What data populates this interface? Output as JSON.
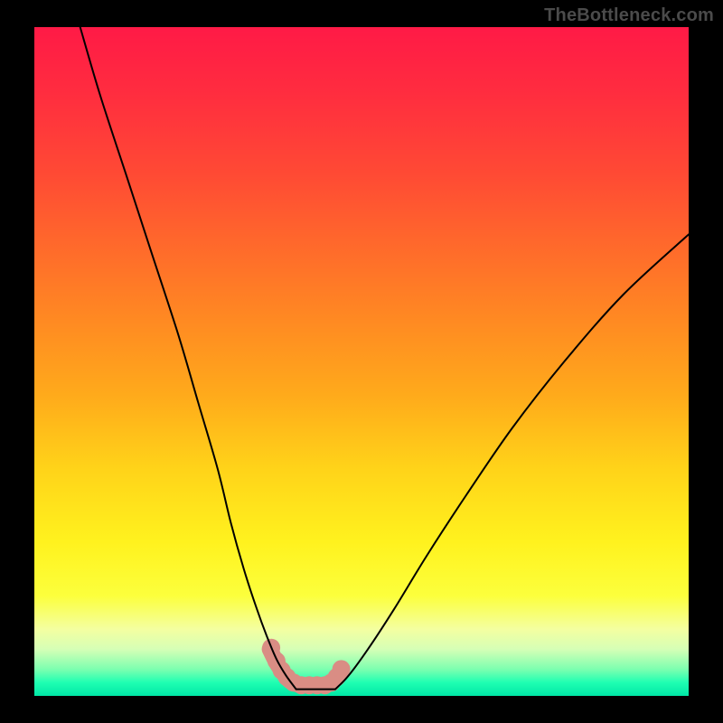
{
  "watermark": "TheBottleneck.com",
  "colors": {
    "frame": "#000000",
    "curve": "#000000",
    "accent": "#d98d84",
    "gradient_top": "#ff1a46",
    "gradient_mid": "#ffd319",
    "gradient_bottom": "#00e7a6"
  },
  "chart_data": {
    "type": "line",
    "title": "",
    "xlabel": "",
    "ylabel": "",
    "xlim": [
      0,
      100
    ],
    "ylim": [
      0,
      100
    ],
    "grid": false,
    "series": [
      {
        "name": "left-curve",
        "x": [
          7,
          10,
          14,
          18,
          22,
          25,
          28,
          30,
          32,
          34,
          35.5,
          37,
          38.5,
          40
        ],
        "values": [
          100,
          90,
          78,
          66,
          54,
          44,
          34,
          26,
          19,
          13,
          9,
          5.5,
          3,
          1
        ]
      },
      {
        "name": "right-curve",
        "x": [
          46,
          48,
          51,
          55,
          60,
          66,
          73,
          81,
          90,
          100
        ],
        "values": [
          1,
          3,
          7,
          13,
          21,
          30,
          40,
          50,
          60,
          69
        ]
      },
      {
        "name": "bottom-flat",
        "x": [
          40,
          42,
          44,
          46
        ],
        "values": [
          1,
          1,
          1,
          1
        ]
      },
      {
        "name": "accent-segment",
        "x": [
          36,
          37,
          38,
          39,
          40,
          41,
          42,
          43,
          44,
          45,
          46,
          47
        ],
        "values": [
          7,
          5,
          3.5,
          2.3,
          1.8,
          1.6,
          1.6,
          1.6,
          1.6,
          1.8,
          2.5,
          4
        ]
      }
    ],
    "accent_dots": [
      {
        "x": 36.2,
        "y": 7.2
      },
      {
        "x": 37.0,
        "y": 5.2
      },
      {
        "x": 37.8,
        "y": 3.8
      },
      {
        "x": 38.6,
        "y": 2.8
      },
      {
        "x": 39.6,
        "y": 2.0
      },
      {
        "x": 40.8,
        "y": 1.6
      },
      {
        "x": 42.0,
        "y": 1.6
      },
      {
        "x": 43.2,
        "y": 1.6
      },
      {
        "x": 44.4,
        "y": 1.6
      },
      {
        "x": 45.4,
        "y": 2.0
      },
      {
        "x": 46.2,
        "y": 2.8
      },
      {
        "x": 46.9,
        "y": 4.0
      }
    ]
  }
}
